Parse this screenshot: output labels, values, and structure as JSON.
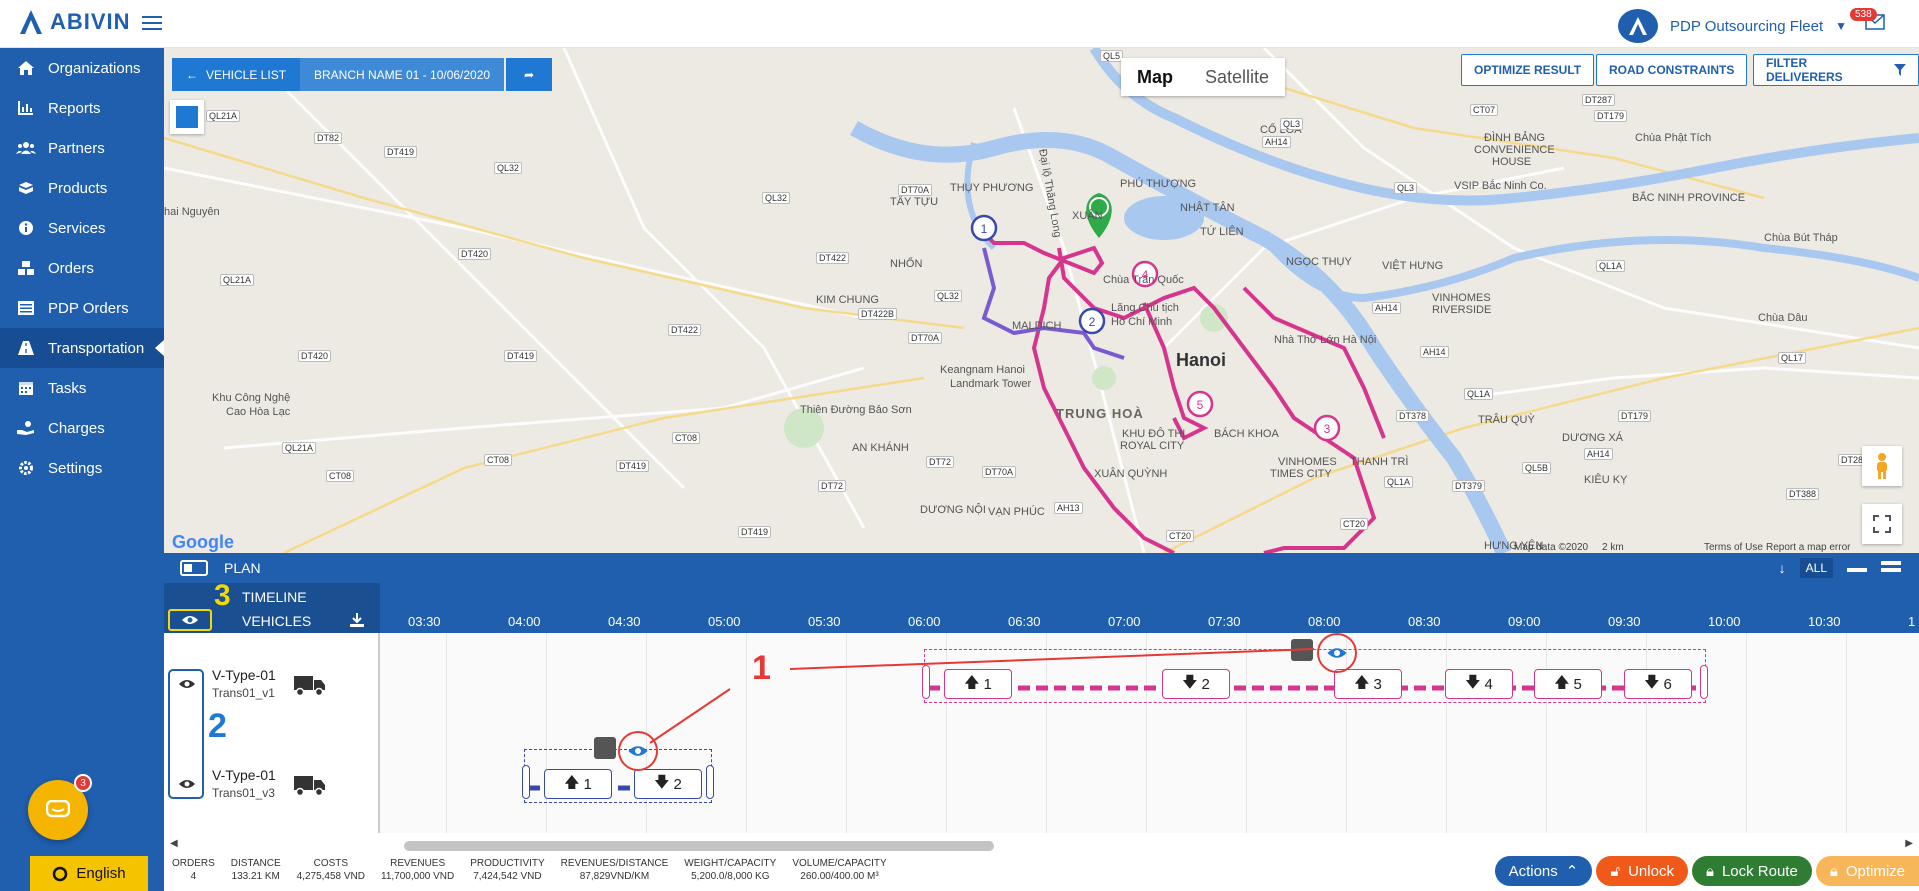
{
  "brand": {
    "name": "ABIVIN"
  },
  "header": {
    "fleet_name": "PDP Outsourcing Fleet",
    "notifications": "538"
  },
  "sidebar": {
    "items": [
      {
        "label": "Organizations",
        "icon": "home-icon"
      },
      {
        "label": "Reports",
        "icon": "chart-icon"
      },
      {
        "label": "Partners",
        "icon": "users-icon"
      },
      {
        "label": "Products",
        "icon": "boxes-icon"
      },
      {
        "label": "Services",
        "icon": "info-icon"
      },
      {
        "label": "Orders",
        "icon": "cubes-icon"
      },
      {
        "label": "PDP Orders",
        "icon": "list-icon"
      },
      {
        "label": "Transportation",
        "icon": "road-icon",
        "active": true
      },
      {
        "label": "Tasks",
        "icon": "calendar-icon"
      },
      {
        "label": "Charges",
        "icon": "hand-coin-icon"
      },
      {
        "label": "Settings",
        "icon": "gear-icon"
      }
    ],
    "chat_badge": "3",
    "language": "English"
  },
  "map": {
    "vehicle_list": "VEHICLE LIST",
    "branch": "BRANCH NAME 01 - 10/06/2020",
    "map_type": [
      "Map",
      "Satellite"
    ],
    "actions": [
      "OPTIMIZE RESULT",
      "ROAD CONSTRAINTS",
      "FILTER DELIVERERS"
    ],
    "city": "Hanoi",
    "labels": {
      "hai_nguyen": "hai Nguyên",
      "khu_cong_nghe": "Khu Công Nghệ",
      "cao_hoa_lac": "Cao Hòa Lạc",
      "thien_duong": "Thiên Đường Bảo Sơn",
      "keangnam_1": "Keangnam Hanoi",
      "keangnam_2": "Landmark Tower",
      "trung_hoa": "TRUNG HOÀ",
      "chua_tran_quoc": "Chùa Trấn Quốc",
      "lang_chu_tich_1": "Lăng Chủ tịch",
      "lang_chu_tich_2": "Hồ Chí Minh",
      "nha_tho": "Nhà Thờ Lớn Hà Nội",
      "vinhomes_riverside_1": "VINHOMES",
      "vinhomes_riverside_2": "RIVERSIDE",
      "viet_hung": "VIỆT HƯNG",
      "vinhomes_city_1": "VINHOMES",
      "vinhomes_city_2": "TIMES CITY",
      "bach_khoa": "BÁCH KHOA",
      "co_loa": "CỔ LOA",
      "dinh_bang_1": "ĐÌNH BẢNG",
      "dinh_bang_2": "CONVENIENCE",
      "dinh_bang_3": "HOUSE",
      "chua_phat_tich": "Chùa Phật Tích",
      "vsip": "VSIP Bắc Ninh Co.",
      "bac_ninh_province_1": "BẮC NINH PROVINCE",
      "chua_but_thap": "Chùa Bút Tháp",
      "chua_dau": "Chùa Dâu",
      "thuy_phuong": "THỤY PHƯƠNG",
      "phu_thuong": "PHÚ THƯỢNG",
      "nhat_tan": "NHẬT TÂN",
      "tu_lien": "TỨ LIÊN",
      "ngoc_thuy": "NGỌC THỤY",
      "xuan_dinh": "XUÂN",
      "tay_tuu": "TÂY TỰU",
      "nhon": "NHỔN",
      "kim_chung": "KIM CHUNG",
      "an_khanh": "AN KHÁNH",
      "van_phuc": "VẠN PHÚC",
      "duong_noi": "DƯƠNG NỘI",
      "thanh_tri": "THANH TRÌ",
      "trau_quy": "TRÂU QUỲ",
      "duong_xa": "DƯƠNG XÁ",
      "kieu_ky": "KIÊU KỴ",
      "hung_yen": "HƯNG YÊN",
      "hoan_kiem": "KHU ĐÔ THỊ",
      "royal_city": "ROYAL CITY",
      "hoi_quynh": "XUÂN QUỲNH",
      "dai_mach": "MALDICH",
      "thang_long": "Đại lộ Thăng Long"
    },
    "roads": [
      "QL21A",
      "DT82",
      "DT419",
      "QL32",
      "DT70A",
      "QL32",
      "DT422",
      "DT420",
      "QL21A",
      "DT422",
      "QL32",
      "DT422B",
      "DT70A",
      "DT420",
      "DT419",
      "CT08",
      "CT08",
      "QL21A",
      "CT08",
      "DT72",
      "DT72",
      "DT419",
      "DT70A",
      "AH13",
      "DT419",
      "QL5",
      "QL3",
      "AH14",
      "QL3",
      "CT07",
      "DT287",
      "DT179",
      "QL1A",
      "AH14",
      "AH14",
      "QL17",
      "QL1A",
      "DT378",
      "DT179",
      "QL5B",
      "DT379",
      "AH14",
      "DT281",
      "DT388",
      "CT20",
      "CT20",
      "QL1A"
    ],
    "google": "Google",
    "map_data": "Map data ©2020",
    "scale": "2 km",
    "terms": "Terms of Use",
    "report": "Report a map error",
    "route_pins": [
      "1",
      "2",
      "4",
      "5",
      "3"
    ]
  },
  "plan": {
    "label": "PLAN",
    "filter_all": "ALL",
    "timeline": "TIMELINE",
    "vehicles": "VEHICLES",
    "ticks": [
      "03:30",
      "04:00",
      "04:30",
      "05:00",
      "05:30",
      "06:00",
      "06:30",
      "07:00",
      "07:30",
      "08:00",
      "08:30",
      "09:00",
      "09:30",
      "10:00",
      "10:30",
      "1"
    ],
    "vehicles_list": [
      {
        "type": "V-Type-01",
        "name": "Trans01_v1"
      },
      {
        "type": "V-Type-01",
        "name": "Trans01_v3"
      }
    ],
    "route_v1_stops": [
      {
        "dir": "up",
        "n": "1"
      },
      {
        "dir": "down",
        "n": "2"
      },
      {
        "dir": "up",
        "n": "3"
      },
      {
        "dir": "down",
        "n": "4"
      },
      {
        "dir": "up",
        "n": "5"
      },
      {
        "dir": "down",
        "n": "6"
      }
    ],
    "route_v3_stops": [
      {
        "dir": "up",
        "n": "1"
      },
      {
        "dir": "down",
        "n": "2"
      }
    ],
    "annotations": {
      "one": "1",
      "two": "2",
      "three": "3"
    }
  },
  "stats": [
    {
      "label": "ORDERS",
      "value": "4"
    },
    {
      "label": "DISTANCE",
      "value": "133.21 KM"
    },
    {
      "label": "COSTS",
      "value": "4,275,458 VND"
    },
    {
      "label": "REVENUES",
      "value": "11,700,000 VND"
    },
    {
      "label": "PRODUCTIVITY",
      "value": "7,424,542 VND"
    },
    {
      "label": "REVENUES/DISTANCE",
      "value": "87,829VND/KM"
    },
    {
      "label": "WEIGHT/CAPACITY",
      "value": "5,200.0/8,000 KG"
    },
    {
      "label": "VOLUME/CAPACITY",
      "value": "260.00/400.00 M³"
    }
  ],
  "bottom_actions": {
    "actions": "Actions",
    "unlock": "Unlock",
    "lock_route": "Lock Route",
    "optimize": "Optimize"
  },
  "colors": {
    "brand": "#1f5fae",
    "route_pink": "#d6358e",
    "route_blue": "#3949ab",
    "unlock": "#ef5a1a",
    "lock_route": "#2e7d32",
    "optimize": "#f7b65a"
  }
}
